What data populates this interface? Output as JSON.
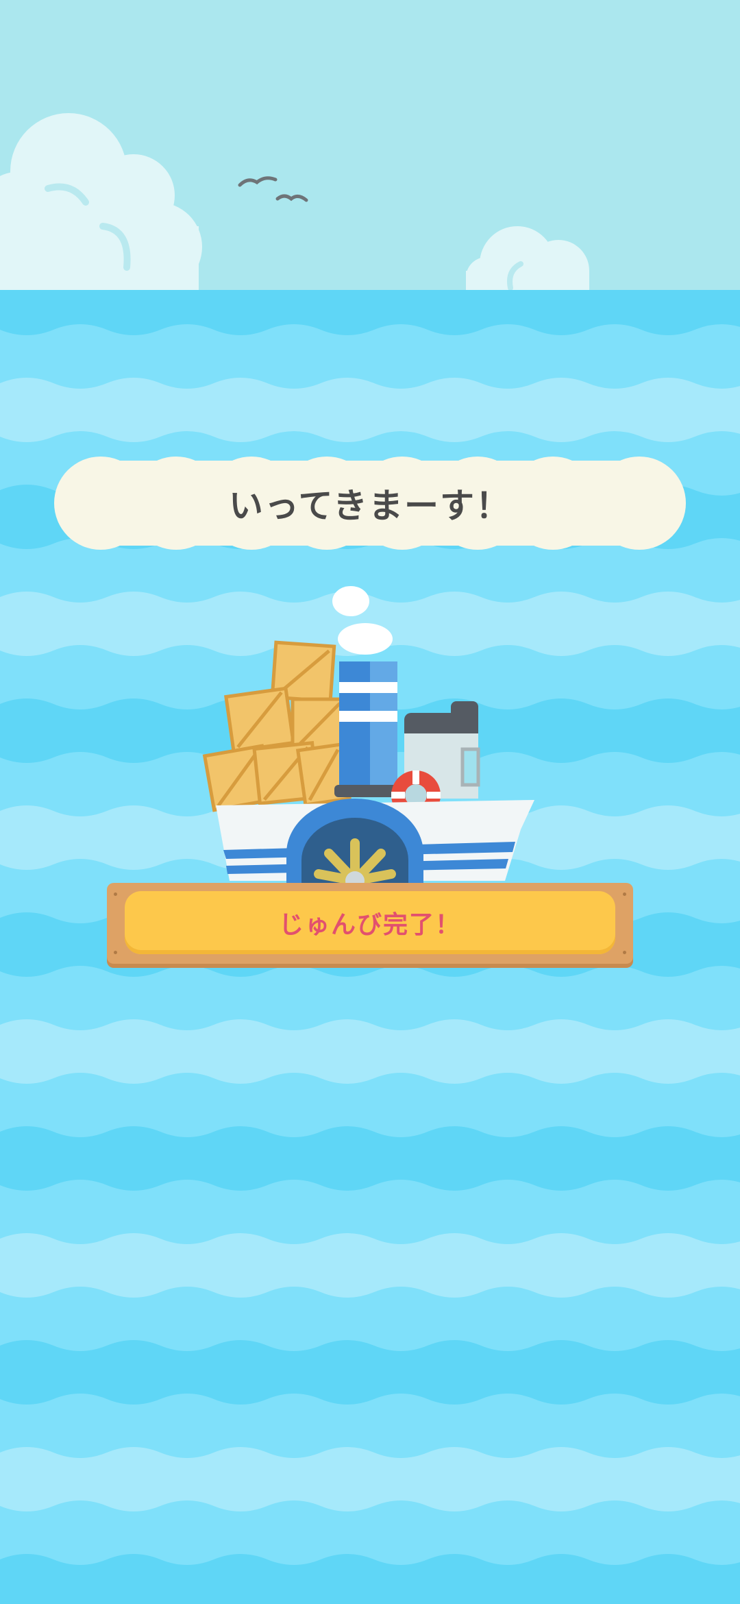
{
  "banner": {
    "message": "いってきまーす！"
  },
  "ready_button": {
    "label": "じゅんび完了！"
  },
  "colors": {
    "sky": "#abe7ee",
    "sea_dark": "#5fd6f6",
    "sea_mid": "#7fe0fa",
    "sea_light": "#a6e9fb",
    "banner_fill": "#f8f6e6",
    "button_wood": "#dea265",
    "button_fill": "#fdc84b",
    "button_text": "#e2506e"
  },
  "icons": [
    "cloud-icon",
    "seagull-icon",
    "steamboat-icon",
    "life-ring-icon",
    "crate-icon",
    "paddle-wheel-icon"
  ]
}
